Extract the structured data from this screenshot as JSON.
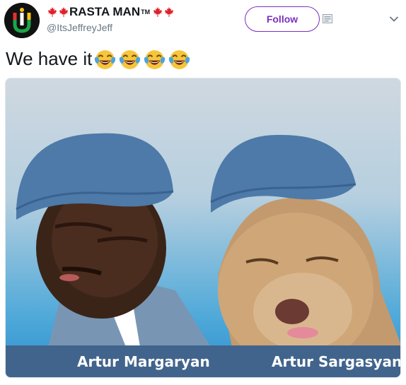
{
  "tweet": {
    "display_name": "RASTA MAN",
    "trademark": "TM",
    "handle": "@ItsJeffreyJeff",
    "follow_label": "Follow",
    "text": "We have it",
    "emoji_name": "face-with-tears-of-joy",
    "emoji_count": 4
  },
  "media": {
    "left_caption": "Artur Margaryan",
    "right_caption": "Artur Sargasyan"
  },
  "colors": {
    "follow_accent": "#7b2fbf",
    "caption_bar": "#41648c",
    "leaf_red": "#e0202b"
  },
  "icons": {
    "avatar": "avatar-logo",
    "leaf": "maple-leaf-icon",
    "card": "card-icon",
    "menu": "chevron-down-icon"
  }
}
